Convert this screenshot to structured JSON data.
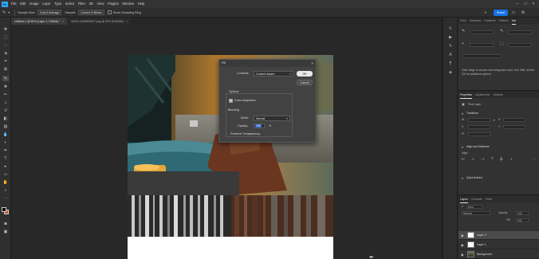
{
  "menubar": {
    "logo": "Ps",
    "items": [
      "File",
      "Edit",
      "Image",
      "Layer",
      "Type",
      "Select",
      "Filter",
      "3D",
      "View",
      "Plugins",
      "Window",
      "Help"
    ]
  },
  "options": {
    "sample_size_label": "Sample Size:",
    "sample_size_value": "5 by 5 Average",
    "sample_label": "Sample:",
    "sample_value": "Current & Below",
    "show_ring_label": "Show Sampling Ring"
  },
  "share_label": "Share",
  "tabs": [
    {
      "label": "Untitled-1 @ 50% (Layer 2, RGB/8) *",
      "close": "×"
    },
    {
      "label": "90932-4256890327.png @ 50% (RGB/8#)",
      "close": "×"
    }
  ],
  "dialog": {
    "title": "Fill",
    "close": "×",
    "contents_label": "Contents:",
    "contents_value": "Content-Aware",
    "ok_label": "OK",
    "cancel_label": "Cancel",
    "options_label": "Options",
    "color_adaptation_label": "Color Adaptation",
    "color_adaptation_checked": true,
    "blending_label": "Blending",
    "mode_label": "Mode:",
    "mode_value": "Normal",
    "opacity_label": "Opacity:",
    "opacity_value": "100",
    "opacity_unit": "%",
    "preserve_transparency_label": "Preserve Transparency",
    "preserve_transparency_checked": false
  },
  "color_panel": {
    "tabs": [
      "Color",
      "Swatches",
      "Gradients",
      "Patterns",
      "Info"
    ],
    "active_tab": "Info",
    "info_text": "Click image to choose new foreground color. Use Shift, Alt and Ctrl for additional options."
  },
  "properties_panel": {
    "tabs": [
      "Properties",
      "Adjustments",
      "Libraries"
    ],
    "active_tab": "Properties",
    "layer_type": "Pixel Layer",
    "transform_label": "Transform",
    "align_label": "Align and Distribute",
    "align_sub": "Align:",
    "quick_actions_label": "Quick Actions"
  },
  "layers_panel": {
    "tabs": [
      "Layers",
      "Channels",
      "Paths"
    ],
    "active_tab": "Layers",
    "kind_label": "Kind",
    "mode_value": "Normal",
    "opacity_label": "Opacity:",
    "opacity_value": "100",
    "fill_label": "Fill:",
    "fill_value": "100",
    "layers": [
      {
        "name": "Layer 2",
        "selected": true,
        "thumb": "white"
      },
      {
        "name": "Layer 1",
        "selected": false,
        "thumb": "white"
      },
      {
        "name": "Background",
        "selected": false,
        "thumb": "photo"
      }
    ]
  },
  "colors": {
    "accent": "#1473e6",
    "foreground": "#000000",
    "background": "#c05a2a"
  }
}
